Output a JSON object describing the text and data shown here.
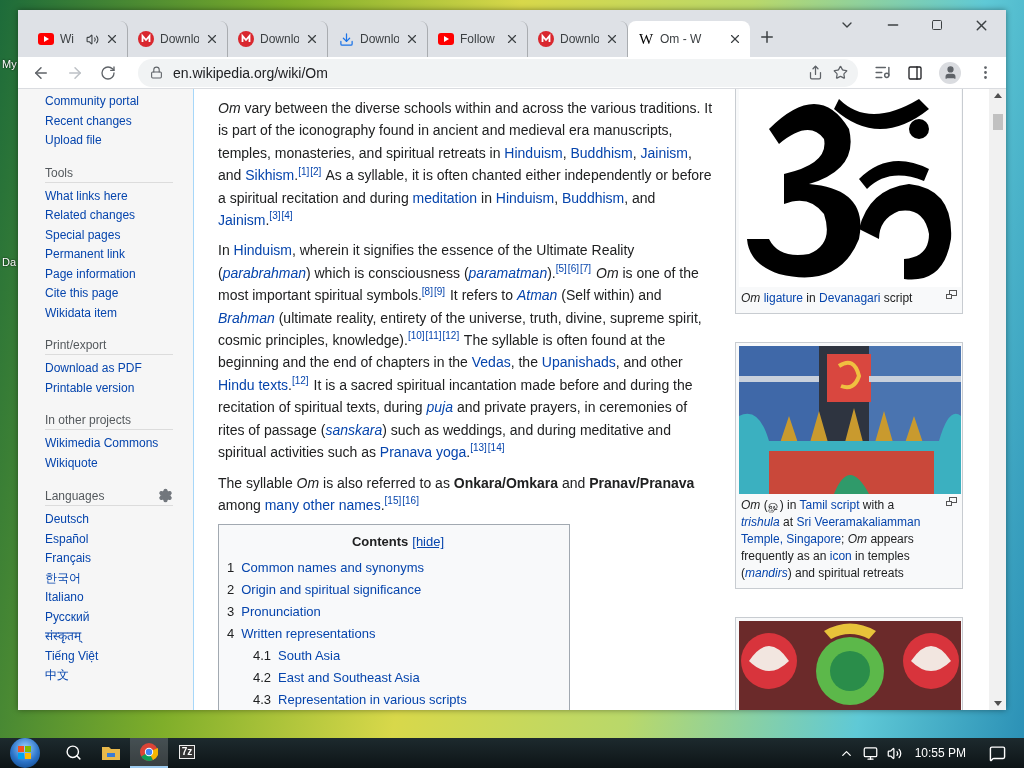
{
  "desktop": {
    "labels": [
      "My",
      "Da"
    ]
  },
  "browser": {
    "tabs": [
      {
        "kind": "youtube",
        "title": "Wi",
        "audio": true,
        "selected": false
      },
      {
        "kind": "mega",
        "title": "Downlo",
        "audio": false,
        "selected": false
      },
      {
        "kind": "mega",
        "title": "Downlo",
        "audio": false,
        "selected": false
      },
      {
        "kind": "download",
        "title": "Downlo",
        "audio": false,
        "selected": false
      },
      {
        "kind": "youtube",
        "title": "Follow",
        "audio": false,
        "selected": false
      },
      {
        "kind": "mega",
        "title": "Downlo",
        "audio": false,
        "selected": false
      },
      {
        "kind": "wikipedia",
        "favicon_text": "W",
        "title": "Om - W",
        "audio": false,
        "selected": true
      }
    ],
    "address": "en.wikipedia.org/wiki/Om"
  },
  "sidebar": {
    "top_links": [
      "Community portal",
      "Recent changes",
      "Upload file"
    ],
    "sections": [
      {
        "heading": "Tools",
        "settings": false,
        "links": [
          "What links here",
          "Related changes",
          "Special pages",
          "Permanent link",
          "Page information",
          "Cite this page",
          "Wikidata item"
        ]
      },
      {
        "heading": "Print/export",
        "settings": false,
        "links": [
          "Download as PDF",
          "Printable version"
        ]
      },
      {
        "heading": "In other projects",
        "settings": false,
        "links": [
          "Wikimedia Commons",
          "Wikiquote"
        ]
      },
      {
        "heading": "Languages",
        "settings": true,
        "links": [
          "Deutsch",
          "Español",
          "Français",
          "한국어",
          "Italiano",
          "Русский",
          "संस्कृतम्",
          "Tiếng Việt",
          "中文"
        ]
      }
    ]
  },
  "article": {
    "paragraphs": [
      [
        {
          "kind": "italic",
          "text": "Om"
        },
        {
          "kind": "plain",
          "text": " vary between the diverse schools within and across the various traditions. It is part of the iconography found in ancient and medieval era manuscripts, temples, monasteries, and spiritual retreats in "
        },
        {
          "kind": "link",
          "text": "Hinduism"
        },
        {
          "kind": "plain",
          "text": ", "
        },
        {
          "kind": "link",
          "text": "Buddhism"
        },
        {
          "kind": "plain",
          "text": ", "
        },
        {
          "kind": "link",
          "text": "Jainism"
        },
        {
          "kind": "plain",
          "text": ", and "
        },
        {
          "kind": "link",
          "text": "Sikhism"
        },
        {
          "kind": "plain",
          "text": "."
        },
        {
          "kind": "ref",
          "text": "[1]"
        },
        {
          "kind": "ref",
          "text": "[2]"
        },
        {
          "kind": "plain",
          "text": " As a syllable, it is often chanted either independently or before a spiritual recitation and during "
        },
        {
          "kind": "link",
          "text": "meditation"
        },
        {
          "kind": "plain",
          "text": " in "
        },
        {
          "kind": "link",
          "text": "Hinduism"
        },
        {
          "kind": "plain",
          "text": ", "
        },
        {
          "kind": "link",
          "text": "Buddhism"
        },
        {
          "kind": "plain",
          "text": ", and "
        },
        {
          "kind": "link",
          "text": "Jainism"
        },
        {
          "kind": "plain",
          "text": "."
        },
        {
          "kind": "ref",
          "text": "[3]"
        },
        {
          "kind": "ref",
          "text": "[4]"
        }
      ],
      [
        {
          "kind": "plain",
          "text": "In "
        },
        {
          "kind": "link",
          "text": "Hinduism"
        },
        {
          "kind": "plain",
          "text": ", wherein it signifies the essence of the Ultimate Reality ("
        },
        {
          "kind": "italic_link",
          "text": "parabrahman"
        },
        {
          "kind": "plain",
          "text": ") which is consciousness ("
        },
        {
          "kind": "italic_link",
          "text": "paramatman"
        },
        {
          "kind": "plain",
          "text": ")."
        },
        {
          "kind": "ref",
          "text": "[5]"
        },
        {
          "kind": "ref",
          "text": "[6]"
        },
        {
          "kind": "ref",
          "text": "[7]"
        },
        {
          "kind": "italic",
          "text": " Om"
        },
        {
          "kind": "plain",
          "text": " is one of the most important spiritual symbols."
        },
        {
          "kind": "ref",
          "text": "[8]"
        },
        {
          "kind": "ref",
          "text": "[9]"
        },
        {
          "kind": "plain",
          "text": " It refers to "
        },
        {
          "kind": "italic_link",
          "text": "Atman"
        },
        {
          "kind": "plain",
          "text": " (Self within) and "
        },
        {
          "kind": "italic_link",
          "text": "Brahman"
        },
        {
          "kind": "plain",
          "text": " (ultimate reality, entirety of the universe, truth, divine, supreme spirit, cosmic principles, knowledge)."
        },
        {
          "kind": "ref",
          "text": "[10]"
        },
        {
          "kind": "ref",
          "text": "[11]"
        },
        {
          "kind": "ref",
          "text": "[12]"
        },
        {
          "kind": "plain",
          "text": " The syllable is often found at the beginning and the end of chapters in the "
        },
        {
          "kind": "link",
          "text": "Vedas"
        },
        {
          "kind": "plain",
          "text": ", the "
        },
        {
          "kind": "link",
          "text": "Upanishads"
        },
        {
          "kind": "plain",
          "text": ", and other "
        },
        {
          "kind": "link",
          "text": "Hindu texts"
        },
        {
          "kind": "plain",
          "text": "."
        },
        {
          "kind": "ref",
          "text": "[12]"
        },
        {
          "kind": "plain",
          "text": " It is a sacred spiritual incantation made before and during the recitation of spiritual texts, during "
        },
        {
          "kind": "italic_link",
          "text": "puja"
        },
        {
          "kind": "plain",
          "text": " and private prayers, in ceremonies of rites of passage ("
        },
        {
          "kind": "italic_link",
          "text": "sanskara"
        },
        {
          "kind": "plain",
          "text": ") such as weddings, and during meditative and spiritual activities such as "
        },
        {
          "kind": "link",
          "text": "Pranava yoga"
        },
        {
          "kind": "plain",
          "text": "."
        },
        {
          "kind": "ref",
          "text": "[13]"
        },
        {
          "kind": "ref",
          "text": "[14]"
        }
      ],
      [
        {
          "kind": "plain",
          "text": "The syllable "
        },
        {
          "kind": "italic",
          "text": "Om"
        },
        {
          "kind": "plain",
          "text": " is also referred to as "
        },
        {
          "kind": "bold",
          "text": "Onkara/Omkara"
        },
        {
          "kind": "plain",
          "text": " and "
        },
        {
          "kind": "bold",
          "text": "Pranav/Pranava"
        },
        {
          "kind": "plain",
          "text": " among "
        },
        {
          "kind": "link",
          "text": "many other names"
        },
        {
          "kind": "plain",
          "text": "."
        },
        {
          "kind": "ref",
          "text": "[15]"
        },
        {
          "kind": "ref",
          "text": "[16]"
        }
      ]
    ]
  },
  "toc": {
    "title": "Contents",
    "toggle": "[hide]",
    "items": [
      {
        "number": "1",
        "label": "Common names and synonyms"
      },
      {
        "number": "2",
        "label": "Origin and spiritual significance"
      },
      {
        "number": "3",
        "label": "Pronunciation"
      },
      {
        "number": "4",
        "label": "Written representations",
        "children": [
          {
            "number": "4.1",
            "label": "South Asia"
          },
          {
            "number": "4.2",
            "label": "East and Southeast Asia"
          },
          {
            "number": "4.3",
            "label": "Representation in various scripts"
          }
        ]
      }
    ]
  },
  "figures": [
    {
      "kind": "symbol",
      "caption": [
        {
          "kind": "italic",
          "text": "Om "
        },
        {
          "kind": "link",
          "text": "ligature"
        },
        {
          "kind": "plain",
          "text": " in "
        },
        {
          "kind": "link",
          "text": "Devanagari"
        },
        {
          "kind": "plain",
          "text": " script"
        }
      ]
    },
    {
      "kind": "temple",
      "caption": [
        {
          "kind": "italic",
          "text": "Om"
        },
        {
          "kind": "plain",
          "text": " (ௐ) in "
        },
        {
          "kind": "link",
          "text": "Tamil script"
        },
        {
          "kind": "plain",
          "text": " with a "
        },
        {
          "kind": "italic_link",
          "text": "trishula"
        },
        {
          "kind": "plain",
          "text": " at "
        },
        {
          "kind": "link",
          "text": "Sri Veeramakaliamman"
        },
        {
          "kind": "link",
          "text": "Temple, Singapore"
        },
        {
          "kind": "plain",
          "text": "; "
        },
        {
          "kind": "italic",
          "text": "Om"
        },
        {
          "kind": "plain",
          "text": " appears frequently as an "
        },
        {
          "kind": "link",
          "text": "icon"
        },
        {
          "kind": "plain",
          "text": " in temples ("
        },
        {
          "kind": "italic_link",
          "text": "mandirs"
        },
        {
          "kind": "plain",
          "text": ") and spiritual retreats"
        }
      ]
    },
    {
      "kind": "rangoli"
    }
  ],
  "taskbar": {
    "apps": [
      {
        "kind": "search",
        "selected": false
      },
      {
        "kind": "folder",
        "selected": false
      },
      {
        "kind": "chrome",
        "selected": true
      },
      {
        "kind": "archive",
        "label": "7z",
        "selected": false
      }
    ],
    "time": "10:55 PM"
  }
}
